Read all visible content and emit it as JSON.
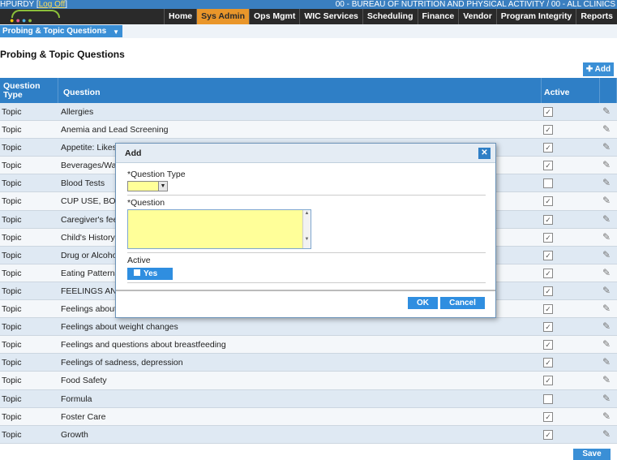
{
  "userbar": {
    "username": "HPURDY",
    "logoff_label": "Log Off",
    "agency": "00 - BUREAU OF NUTRITION AND PHYSICAL ACTIVITY / 00 - ALL CLINICS"
  },
  "nav": {
    "items": [
      "Home",
      "Sys Admin",
      "Ops Mgmt",
      "WIC Services",
      "Scheduling",
      "Finance",
      "Vendor",
      "Program Integrity",
      "Reports"
    ],
    "active": "Sys Admin"
  },
  "subnav": {
    "dropdown_label": "Probing & Topic Questions"
  },
  "page": {
    "title": "Probing & Topic Questions",
    "add_label": "Add",
    "save_label": "Save"
  },
  "table": {
    "headers": {
      "type": "Question Type",
      "question": "Question",
      "active": "Active"
    },
    "rows": [
      {
        "type": "Topic",
        "question": "Allergies",
        "active": true
      },
      {
        "type": "Topic",
        "question": "Anemia and Lead Screening",
        "active": true
      },
      {
        "type": "Topic",
        "question": "Appetite: Likes,",
        "active": true
      },
      {
        "type": "Topic",
        "question": "Beverages/Wate",
        "active": true
      },
      {
        "type": "Topic",
        "question": "Blood Tests",
        "active": false
      },
      {
        "type": "Topic",
        "question": "CUP USE, BOTT",
        "active": true
      },
      {
        "type": "Topic",
        "question": "Caregiver's feel",
        "active": true
      },
      {
        "type": "Topic",
        "question": "Child's History o",
        "active": true
      },
      {
        "type": "Topic",
        "question": "Drug or Alcohol",
        "active": true
      },
      {
        "type": "Topic",
        "question": "Eating Patterns",
        "active": true
      },
      {
        "type": "Topic",
        "question": "FEELINGS AND",
        "active": true
      },
      {
        "type": "Topic",
        "question": "Feelings about",
        "active": true
      },
      {
        "type": "Topic",
        "question": "Feelings about weight changes",
        "active": true
      },
      {
        "type": "Topic",
        "question": "Feelings and questions about breastfeeding",
        "active": true
      },
      {
        "type": "Topic",
        "question": "Feelings of sadness, depression",
        "active": true
      },
      {
        "type": "Topic",
        "question": "Food Safety",
        "active": true
      },
      {
        "type": "Topic",
        "question": "Formula",
        "active": false
      },
      {
        "type": "Topic",
        "question": "Foster Care",
        "active": true
      },
      {
        "type": "Topic",
        "question": "Growth",
        "active": true
      }
    ]
  },
  "dialog": {
    "title": "Add",
    "question_type_label": "*Question Type",
    "question_type_value": "",
    "question_label": "*Question",
    "question_value": "",
    "active_label": "Active",
    "active_toggle_label": "Yes",
    "ok_label": "OK",
    "cancel_label": "Cancel"
  },
  "icons": {
    "close": "close-icon",
    "add": "plus-icon",
    "edit": "pencil-icon",
    "checkbox": "checkbox-icon"
  },
  "colors": {
    "primary_blue": "#2f7fc6",
    "nav_active": "#e9962a",
    "required_field": "#ffff99"
  }
}
